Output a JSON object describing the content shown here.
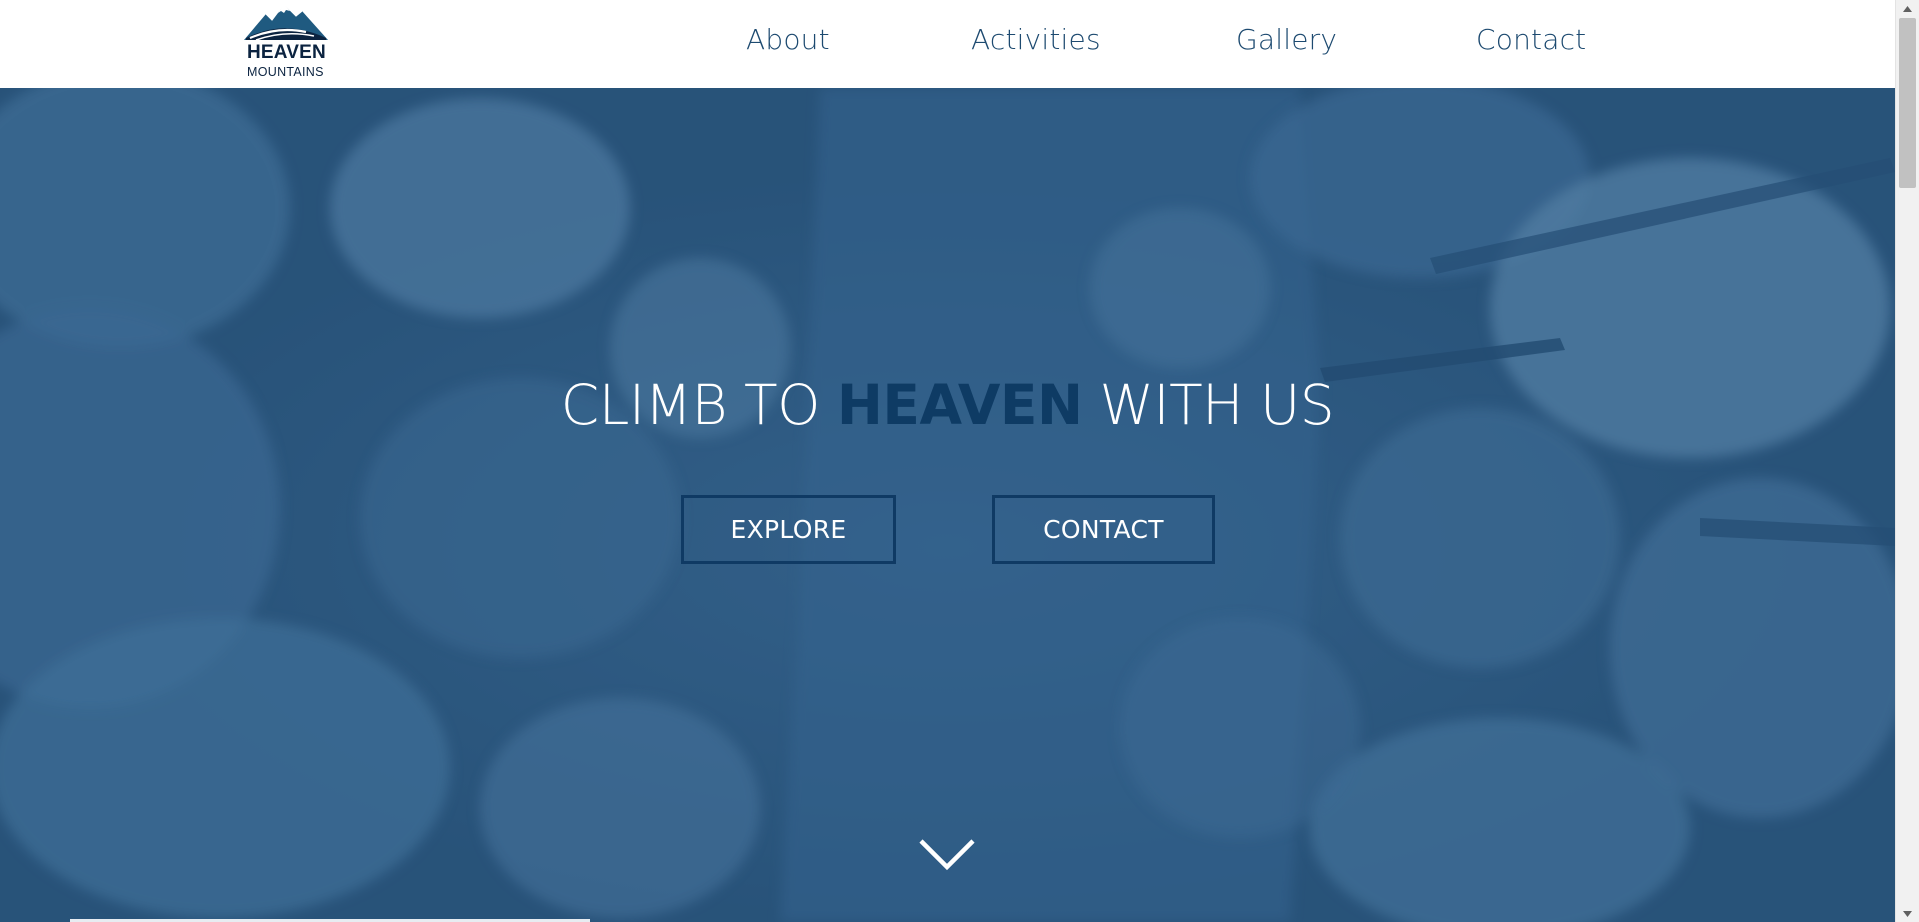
{
  "brand": {
    "name": "HEAVEN",
    "tagline": "MOUNTAINS",
    "logo_icon": "mountain-icon",
    "color": "#0b2340"
  },
  "nav": {
    "items": [
      {
        "label": "About"
      },
      {
        "label": "Activities"
      },
      {
        "label": "Gallery"
      },
      {
        "label": "Contact"
      }
    ]
  },
  "hero": {
    "title_before": "CLIMB TO ",
    "title_accent": "HEAVEN",
    "title_after": " WITH US",
    "accent_color": "#0e3b64",
    "buttons": {
      "explore": "EXPLORE",
      "contact": "CONTACT"
    },
    "scroll_icon": "chevron-down-icon",
    "background": "aerial-snowy-forest-image"
  },
  "scrollbar": {
    "up_icon": "triangle-up-icon",
    "down_icon": "triangle-down-icon"
  }
}
